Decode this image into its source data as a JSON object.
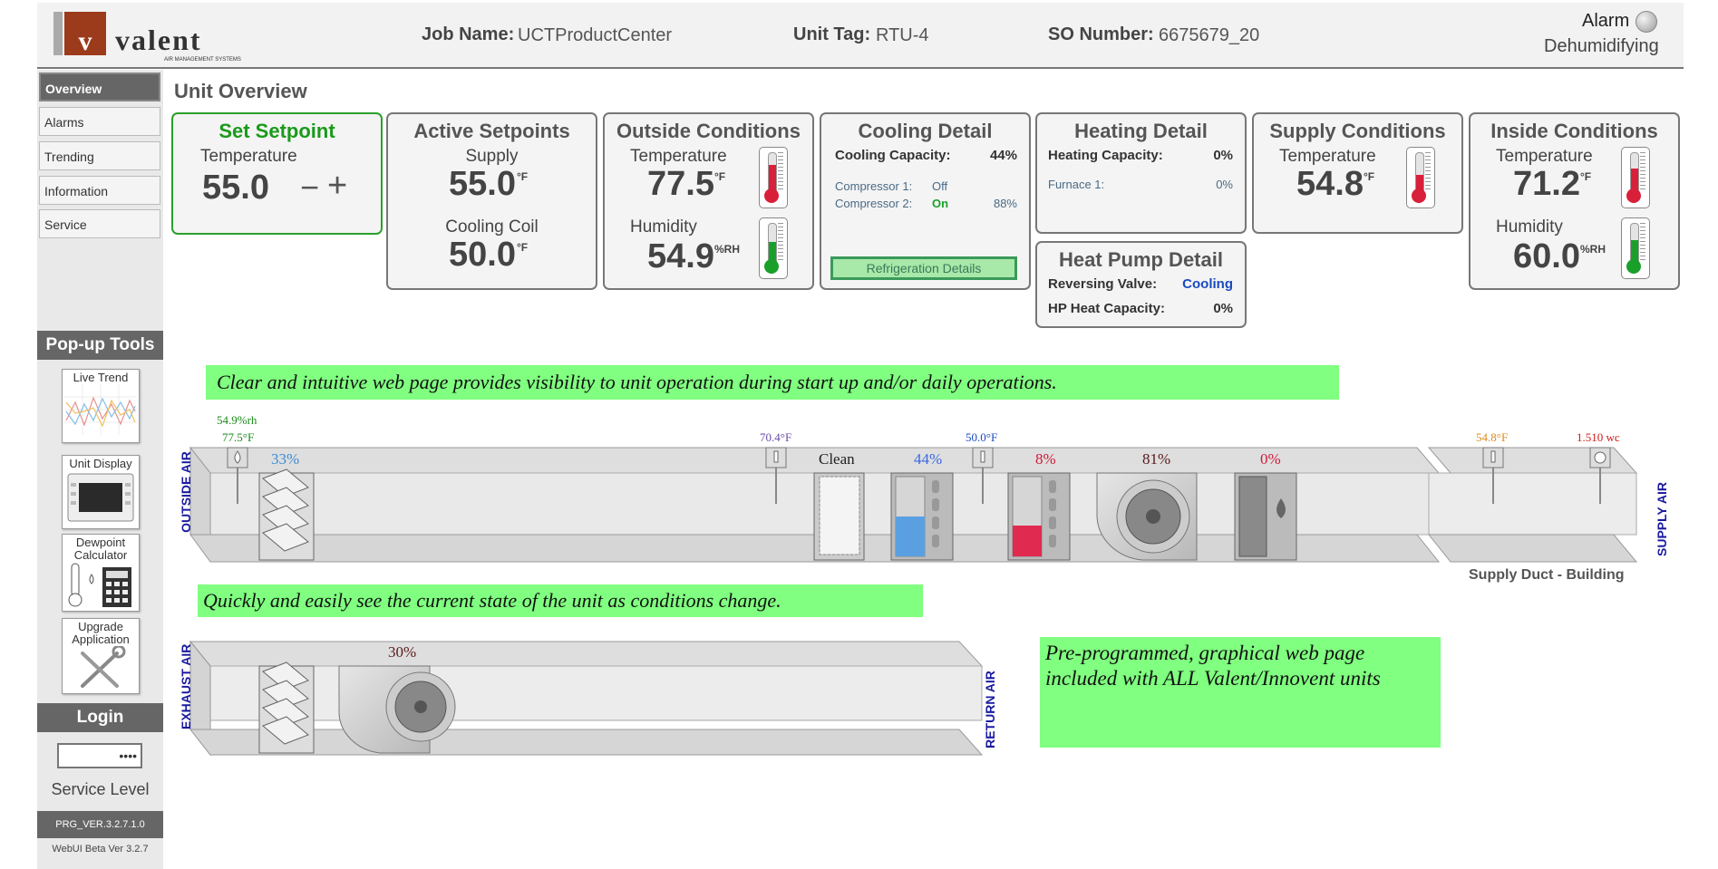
{
  "header": {
    "logo_text": "valent",
    "logo_tagline": "AIR MANAGEMENT SYSTEMS",
    "job_name_label": "Job Name:",
    "job_name_value": "UCTProductCenter",
    "unit_tag_label": "Unit Tag:",
    "unit_tag_value": "RTU-4",
    "so_number_label": "SO Number:",
    "so_number_value": "6675679_20",
    "alarm_label": "Alarm",
    "mode_label": "Dehumidifying"
  },
  "sidebar": {
    "nav": [
      {
        "label": "Overview",
        "active": true
      },
      {
        "label": "Alarms"
      },
      {
        "label": "Trending"
      },
      {
        "label": "Information"
      },
      {
        "label": "Service"
      }
    ],
    "popup_header": "Pop-up Tools",
    "tools": [
      {
        "label": "Live Trend",
        "icon": "trend-chart-icon"
      },
      {
        "label": "Unit Display",
        "icon": "unit-display-icon"
      },
      {
        "label": "Dewpoint Calculator",
        "icon": "calculator-icon"
      },
      {
        "label": "Upgrade Application",
        "icon": "tools-icon"
      }
    ],
    "login_header": "Login",
    "password_mask": "••••",
    "service_level": "Service Level",
    "prg_version": "PRG_VER.3.2.7.1.0",
    "webui_version": "WebUI Beta Ver 3.2.7"
  },
  "page_title": "Unit Overview",
  "panels": {
    "set_setpoint": {
      "title": "Set Setpoint",
      "label": "Temperature",
      "value": "55.0",
      "minus": "−",
      "plus": "+"
    },
    "active_setpoints": {
      "title": "Active Setpoints",
      "supply_label": "Supply",
      "supply_value": "55.0",
      "coil_label": "Cooling Coil",
      "coil_value": "50.0",
      "unit": "°F"
    },
    "outside": {
      "title": "Outside Conditions",
      "temp_label": "Temperature",
      "temp_value": "77.5",
      "temp_unit": "°F",
      "hum_label": "Humidity",
      "hum_value": "54.9",
      "hum_unit": "%RH",
      "temp_level": 0.7,
      "hum_level": 0.55
    },
    "cooling": {
      "title": "Cooling Detail",
      "capacity_label": "Cooling Capacity:",
      "capacity_value": "44%",
      "comp1_label": "Compressor 1:",
      "comp1_state": "Off",
      "comp2_label": "Compressor 2:",
      "comp2_state": "On",
      "comp2_value": "88%",
      "button": "Refrigeration Details"
    },
    "heating": {
      "title": "Heating Detail",
      "capacity_label": "Heating Capacity:",
      "capacity_value": "0%",
      "furnace_label": "Furnace 1:",
      "furnace_value": "0%"
    },
    "heatpump": {
      "title": "Heat Pump Detail",
      "rv_label": "Reversing Valve:",
      "rv_value": "Cooling",
      "hp_label": "HP Heat Capacity:",
      "hp_value": "0%"
    },
    "supply": {
      "title": "Supply Conditions",
      "temp_label": "Temperature",
      "temp_value": "54.8",
      "temp_unit": "°F",
      "temp_level": 0.45
    },
    "inside": {
      "title": "Inside Conditions",
      "temp_label": "Temperature",
      "temp_value": "71.2",
      "temp_unit": "°F",
      "hum_label": "Humidity",
      "hum_value": "60.0",
      "hum_unit": "%RH",
      "temp_level": 0.62,
      "hum_level": 0.6
    }
  },
  "callouts": {
    "top": "Clear and intuitive web page provides visibility to unit operation during start up and/or daily operations.",
    "middle": "Quickly and easily see the current state of the unit as conditions change.",
    "right": "Pre-programmed, graphical web page included with ALL Valent/Innovent units"
  },
  "diagram": {
    "outside_rh": "54.9%rh",
    "outside_temp": "77.5°F",
    "outside_damper_pct": "33%",
    "mixed_temp": "70.4°F",
    "filter_state": "Clean",
    "cooling_pct": "44%",
    "coil_temp": "50.0°F",
    "reheat_pct": "8%",
    "fan_pct": "81%",
    "heat_pct": "0%",
    "supply_temp": "54.8°F",
    "static_pressure": "1.510 wc",
    "supply_duct_label": "Supply Duct - Building",
    "outside_air_label": "OUTSIDE AIR",
    "supply_air_label": "SUPPLY AIR",
    "exhaust_air_label": "EXHAUST AIR",
    "return_air_label": "RETURN AIR",
    "exhaust_fan_pct": "30%"
  },
  "colors": {
    "setpoint_green": "#1a9a1a",
    "temp_red": "#d8203a",
    "hum_green": "#1aa02a",
    "callout_bg": "#80ff80",
    "duct_label_blue": "#1a1aa0"
  }
}
